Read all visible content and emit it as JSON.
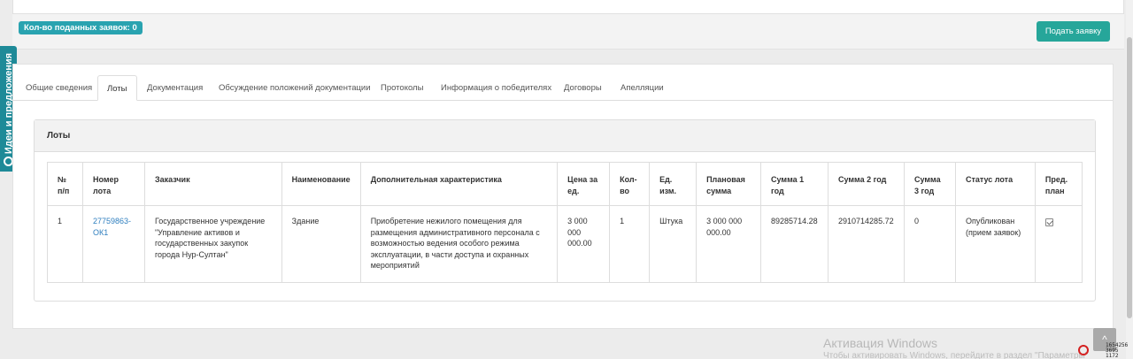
{
  "header": {
    "applications_badge": "Кол-во поданных заявок: 0",
    "submit_button": "Подать заявку"
  },
  "side_tab": {
    "label": "Идеи и предложения"
  },
  "tabs": [
    {
      "label": "Общие сведения",
      "active": false
    },
    {
      "label": "Лоты",
      "active": true
    },
    {
      "label": "Документация",
      "active": false
    },
    {
      "label": "Обсуждение положений документации",
      "active": false
    },
    {
      "label": "Протоколы",
      "active": false
    },
    {
      "label": "Информация о победителях",
      "active": false
    },
    {
      "label": "Договоры",
      "active": false
    },
    {
      "label": "Апелляции",
      "active": false
    }
  ],
  "lots": {
    "title": "Лоты",
    "columns": [
      "№ п/п",
      "Номер лота",
      "Заказчик",
      "Наименование",
      "Дополнительная характеристика",
      "Цена за ед.",
      "Кол-во",
      "Ед. изм.",
      "Плановая сумма",
      "Сумма 1 год",
      "Сумма 2 год",
      "Сумма 3 год",
      "Статус лота",
      "Пред. план"
    ],
    "rows": [
      {
        "num": "1",
        "lot_number": "27759863-ОК1",
        "customer": "Государственное учреждение \"Управление активов и государственных закупок города Нур-Султан\"",
        "name": "Здание",
        "extra": "Приобретение нежилого помещения для размещения административного персонала с возможностью ведения особого режима эксплуатации, в части доступа и охранных мероприятий",
        "unit_price": "3 000 000 000.00",
        "qty": "1",
        "unit": "Штука",
        "planned_sum": "3 000 000 000.00",
        "sum_year1": "89285714.28",
        "sum_year2": "2910714285.72",
        "sum_year3": "0",
        "status": "Опубликован (прием заявок)",
        "pre_plan_checked": true
      }
    ]
  },
  "watermark": {
    "title": "Активация Windows",
    "subtitle": "Чтобы активировать Windows, перейдите в раздел \"Параметры\"."
  },
  "tray": {
    "line1": "1654256",
    "line2": "3695",
    "line3": "1172"
  }
}
